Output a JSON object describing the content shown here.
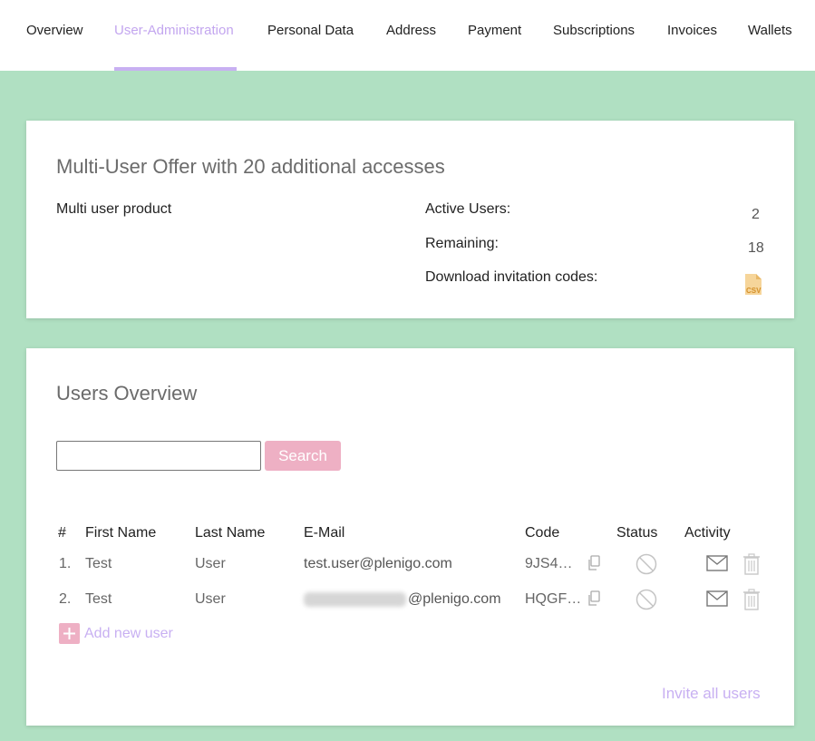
{
  "nav": {
    "items": [
      {
        "label": "Overview",
        "active": false
      },
      {
        "label": "User-Administration",
        "active": true
      },
      {
        "label": "Personal Data",
        "active": false
      },
      {
        "label": "Address",
        "active": false
      },
      {
        "label": "Payment",
        "active": false
      },
      {
        "label": "Subscriptions",
        "active": false
      },
      {
        "label": "Invoices",
        "active": false
      },
      {
        "label": "Wallets",
        "active": false
      }
    ]
  },
  "offer": {
    "title": "Multi-User Offer with 20 additional accesses",
    "product": "Multi user product",
    "active_users_label": "Active Users:",
    "active_users_value": "2",
    "remaining_label": "Remaining:",
    "remaining_value": "18",
    "download_label": "Download invitation codes:",
    "csv_icon": "csv-file-icon",
    "csv_text": "CSV"
  },
  "users_overview": {
    "title": "Users Overview",
    "search": {
      "value": "",
      "placeholder": "",
      "button_label": "Search"
    },
    "columns": [
      "#",
      "First Name",
      "Last Name",
      "E-Mail",
      "Code",
      "Status",
      "Activity"
    ],
    "rows": [
      {
        "index": "1.",
        "first_name": "Test",
        "last_name": "User",
        "email": "test.user@plenigo.com",
        "email_redacted": false,
        "code": "9JS4…"
      },
      {
        "index": "2.",
        "first_name": "Test",
        "last_name": "User",
        "email": "@plenigo.com",
        "email_redacted": true,
        "code": "HQGF…"
      }
    ],
    "add_user_label": "Add new user",
    "invite_all_label": "Invite all users"
  },
  "colors": {
    "background": "#b0e0c2",
    "accent_purple": "#c8b0f2",
    "accent_pink": "#eeb0c4"
  }
}
